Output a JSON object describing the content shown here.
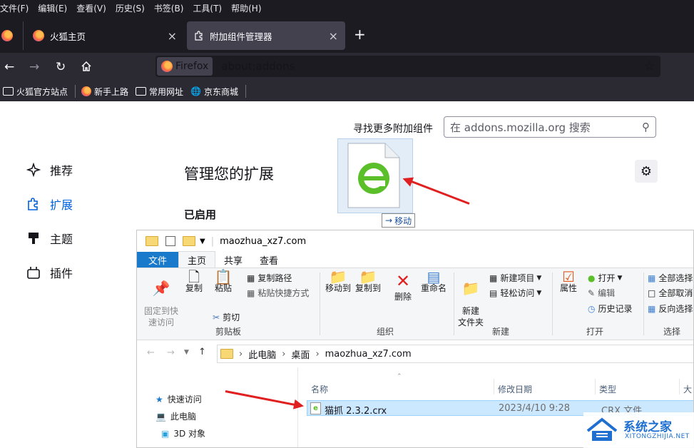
{
  "menu": [
    "文件(F)",
    "编辑(E)",
    "查看(V)",
    "历史(S)",
    "书签(B)",
    "工具(T)",
    "帮助(H)"
  ],
  "tabs": [
    {
      "label": "火狐主页",
      "close": "×"
    },
    {
      "label": "附加组件管理器",
      "close": "×"
    }
  ],
  "new_tab": "+",
  "url": {
    "identity": "Firefox",
    "address": "about:addons"
  },
  "bookmarks": [
    "火狐官方站点",
    "新手上路",
    "常用网址",
    "京东商城"
  ],
  "addons": {
    "find_more": "寻找更多附加组件",
    "search_placeholder": "在 addons.mozilla.org 搜索",
    "sidebar": [
      "推荐",
      "扩展",
      "主题",
      "插件"
    ],
    "heading": "管理您的扩展",
    "enabled": "已启用",
    "drag_tooltip": "移动"
  },
  "explorer": {
    "title": "maozhua_xz7.com",
    "ribbon_tabs": [
      "文件",
      "主页",
      "共享",
      "查看"
    ],
    "clipboard": {
      "pin": "固定到快\n速访问",
      "copy": "复制",
      "paste": "粘贴",
      "copy_path": "复制路径",
      "paste_shortcut": "粘贴快捷方式",
      "cut": "剪切",
      "group": "剪贴板"
    },
    "organize": {
      "move_to": "移动到",
      "copy_to": "复制到",
      "delete": "删除",
      "rename": "重命名",
      "group": "组织"
    },
    "new": {
      "new_folder": "新建\n文件夹",
      "new_item": "新建项目",
      "easy_access": "轻松访问",
      "group": "新建"
    },
    "open": {
      "properties": "属性",
      "open": "打开",
      "edit": "编辑",
      "history": "历史记录",
      "group": "打开"
    },
    "select": {
      "select_all": "全部选择",
      "select_none": "全部取消",
      "invert": "反向选择",
      "group": "选择"
    },
    "breadcrumb": [
      "此电脑",
      "桌面",
      "maozhua_xz7.com"
    ],
    "nav": [
      "快速访问",
      "此电脑",
      "3D 对象"
    ],
    "columns": [
      "名称",
      "修改日期",
      "类型",
      "大"
    ],
    "file": {
      "name": "猫抓 2.3.2.crx",
      "date": "2023/4/10 9:28",
      "type": "CRX 文件"
    }
  },
  "watermark": {
    "name": "系统之家",
    "url": "XITONGZHIJIA.NET"
  }
}
